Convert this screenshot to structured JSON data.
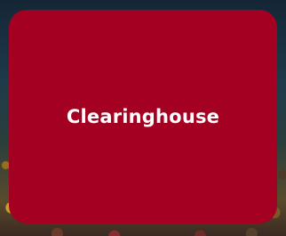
{
  "card": {
    "title": "Clearinghouse",
    "background_color": "#a40022",
    "text_color": "#ffffff"
  }
}
